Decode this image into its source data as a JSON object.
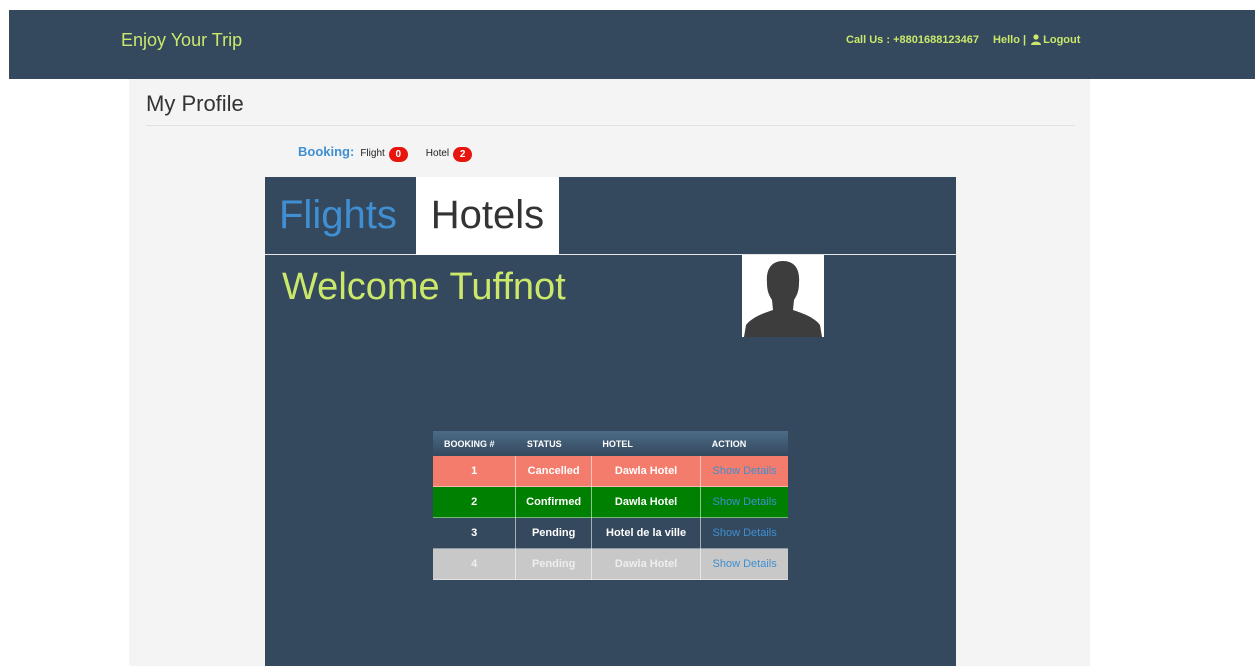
{
  "navbar": {
    "brand": "Enjoy Your Trip",
    "call_us": "Call Us : +8801688123467",
    "hello": "Hello |",
    "logout": "Logout"
  },
  "page": {
    "title": "My Profile"
  },
  "booking_summary": {
    "label": "Booking:",
    "flight_label": "Flight",
    "flight_count": "0",
    "hotel_label": "Hotel",
    "hotel_count": "2"
  },
  "tabs": {
    "flights": "Flights",
    "hotels": "Hotels",
    "active": "Hotels"
  },
  "welcome": "Welcome Tuffnot",
  "bookings_table": {
    "headers": [
      "BOOKING #",
      "STATUS",
      "HOTEL",
      "ACTION"
    ],
    "rows": [
      {
        "booking": "1",
        "status": "Cancelled",
        "hotel": "Dawla Hotel",
        "action": "Show Details",
        "bg": "#f47c6c",
        "text": "#ffffff",
        "link": "#3f8fd2"
      },
      {
        "booking": "2",
        "status": "Confirmed",
        "hotel": "Dawla Hotel",
        "action": "Show Details",
        "bg": "#008000",
        "text": "#ffffff",
        "link": "#3f8fd2"
      },
      {
        "booking": "3",
        "status": "Pending",
        "hotel": "Hotel de la ville",
        "action": "Show Details",
        "bg": "#34495e",
        "text": "#ffffff",
        "link": "#3f8fd2"
      },
      {
        "booking": "4",
        "status": "Pending",
        "hotel": "Dawla Hotel",
        "action": "Show Details",
        "bg": "#c8c8c8",
        "text": "#eeeeee",
        "link": "#3f8fd2"
      }
    ]
  },
  "colors": {
    "navbar_bg": "#34495e",
    "accent_lime": "#cbe86b",
    "link_blue": "#3f8fd2",
    "badge_red": "#e8140e"
  },
  "icons": {
    "user": "user-icon",
    "avatar": "profile-silhouette"
  }
}
